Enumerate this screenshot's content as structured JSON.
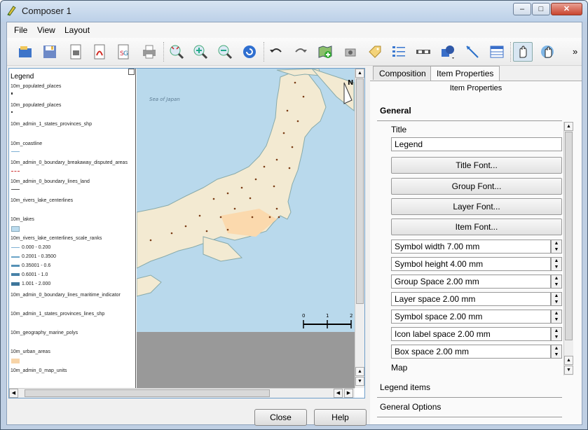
{
  "window": {
    "title": "Composer 1",
    "min_label": "–",
    "max_label": "□",
    "close_label": "✕"
  },
  "menu": [
    "File",
    "View",
    "Layout"
  ],
  "toolbar": {
    "icons": [
      "open-icon",
      "save-icon",
      "export-image-icon",
      "export-pdf-icon",
      "export-svg-icon",
      "print-icon",
      "zoom-full-icon",
      "zoom-in-icon",
      "zoom-out-icon",
      "refresh-icon",
      "undo-icon",
      "redo-icon",
      "add-map-icon",
      "add-image-icon",
      "add-label-icon",
      "add-legend-icon",
      "add-scalebar-icon",
      "add-shape-icon",
      "add-arrow-icon",
      "add-table-icon",
      "select-item-icon",
      "move-content-icon"
    ],
    "more_label": "»"
  },
  "legend": {
    "title": "Legend",
    "items": [
      {
        "label": "10m_populated_places"
      },
      {
        "label": "10m_populated_places"
      },
      {
        "label": "10m_admin_1_states_provinces_shp"
      },
      {
        "label": "10m_coastline"
      },
      {
        "label": "10m_admin_0_boundary_breakaway_disputed_areas"
      },
      {
        "label": "10m_admin_0_boundary_lines_land"
      },
      {
        "label": "10m_rivers_lake_centerlines"
      },
      {
        "label": "10m_lakes"
      },
      {
        "label": "10m_rivers_lake_centerlines_scale_ranks"
      }
    ],
    "ranks": [
      "0.000 - 0.200",
      "0.2001 - 0.3500",
      "0.35001 - 0.6",
      "0.6001 - 1.0",
      "1.001 - 2.000"
    ],
    "more_items": [
      "10m_admin_0_boundary_lines_maritime_indicator",
      "10m_admin_1_states_provinces_lines_shp",
      "10m_geography_marine_polys",
      "10m_urban_areas",
      "10m_admin_0_map_units"
    ]
  },
  "map": {
    "sea_label": "Sea of Japan",
    "north_label": "N",
    "scale_ticks": [
      "0",
      "1",
      "2"
    ]
  },
  "tabs": [
    "Composition",
    "Item Properties"
  ],
  "panel": {
    "header": "Item Properties",
    "general": "General",
    "title_label": "Title",
    "title_value": "Legend",
    "buttons": [
      "Title Font...",
      "Group Font...",
      "Layer Font...",
      "Item Font..."
    ],
    "spins": [
      "Symbol width 7.00 mm",
      "Symbol height 4.00 mm",
      "Group Space 2.00 mm",
      "Layer space 2.00 mm",
      "Symbol space 2.00 mm",
      "Icon label space 2.00 mm",
      "Box space 2.00 mm"
    ],
    "map_label": "Map",
    "legend_items": "Legend items",
    "general_options": "General Options"
  },
  "footer": {
    "close": "Close",
    "help": "Help"
  },
  "colors": {
    "accent": "#6e9ec9",
    "sea": "#b9d9ec",
    "land": "#f3ead2"
  }
}
